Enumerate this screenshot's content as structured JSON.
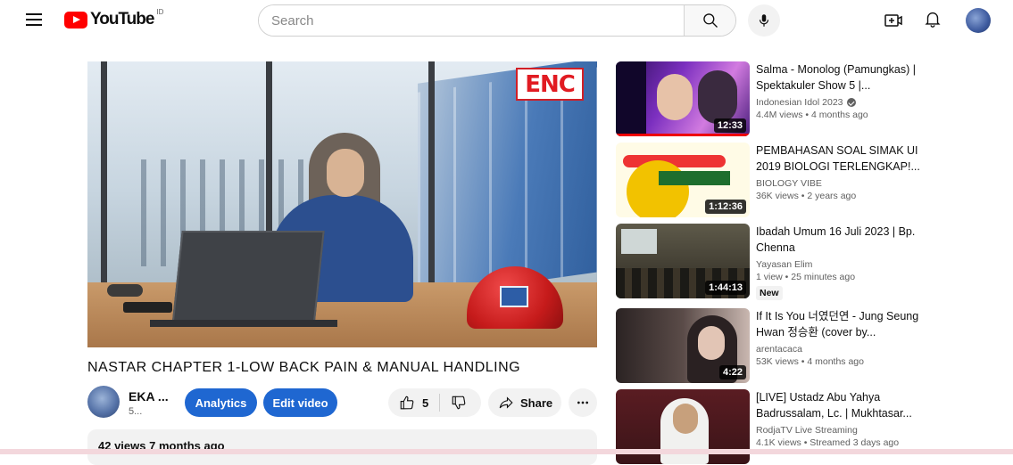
{
  "header": {
    "logo_text": "YouTube",
    "country_code": "ID",
    "search_placeholder": "Search"
  },
  "video": {
    "title": "NASTAR CHAPTER 1-LOW BACK PAIN & MANUAL HANDLING",
    "badge_text": "ENC",
    "channel_name": "EKA ...",
    "subscribers": "5...",
    "analytics_label": "Analytics",
    "edit_label": "Edit video",
    "like_count": "5",
    "share_label": "Share",
    "description_stats": "42 views  7 months ago"
  },
  "recommendations": [
    {
      "title": "Salma - Monolog (Pamungkas) | Spektakuler Show 5 |...",
      "channel": "Indonesian Idol 2023",
      "verified": true,
      "meta": "4.4M views • 4 months ago",
      "duration": "12:33"
    },
    {
      "title": "PEMBAHASAN SOAL SIMAK UI 2019 BIOLOGI TERLENGKAP!...",
      "channel": "BIOLOGY VIBE",
      "meta": "36K views • 2 years ago",
      "duration": "1:12:36"
    },
    {
      "title": "Ibadah Umum 16 Juli 2023 | Bp. Chenna",
      "channel": "Yayasan Elim",
      "meta": "1 view • 25 minutes ago",
      "badge": "New",
      "duration": "1:44:13"
    },
    {
      "title": "If It Is You 너였던연 - Jung Seung Hwan 정승환 (cover by...",
      "channel": "arentacaca",
      "meta": "53K views • 4 months ago",
      "duration": "4:22"
    },
    {
      "title": "[LIVE] Ustadz Abu Yahya Badrussalam, Lc. | Mukhtasar...",
      "channel": "RodjaTV Live Streaming",
      "meta": "4.1K views • Streamed 3 days ago"
    }
  ],
  "colors": {
    "accent_blue": "#1f67d1",
    "youtube_red": "#ff0000",
    "chip_gray": "#f2f2f2"
  }
}
